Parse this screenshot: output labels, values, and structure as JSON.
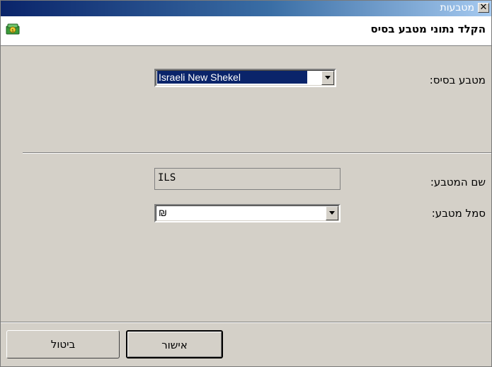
{
  "window": {
    "title": "מטבעות",
    "close_label": "✕"
  },
  "header": {
    "title": "הקלד נתוני מטבע בסיס",
    "icon": "currency-money-icon"
  },
  "form": {
    "base_currency_label": "מטבע בסיס:",
    "base_currency_value": "Israeli New Shekel",
    "currency_name_label": "שם המטבע:",
    "currency_name_value": "ILS",
    "currency_symbol_label": "סמל מטבע:",
    "currency_symbol_value": "₪"
  },
  "buttons": {
    "ok_label": "אישור",
    "cancel_label": "ביטול"
  },
  "colors": {
    "title_bar_start": "#0a246a",
    "title_bar_end": "#a6caf0",
    "face": "#d4d0c8"
  }
}
